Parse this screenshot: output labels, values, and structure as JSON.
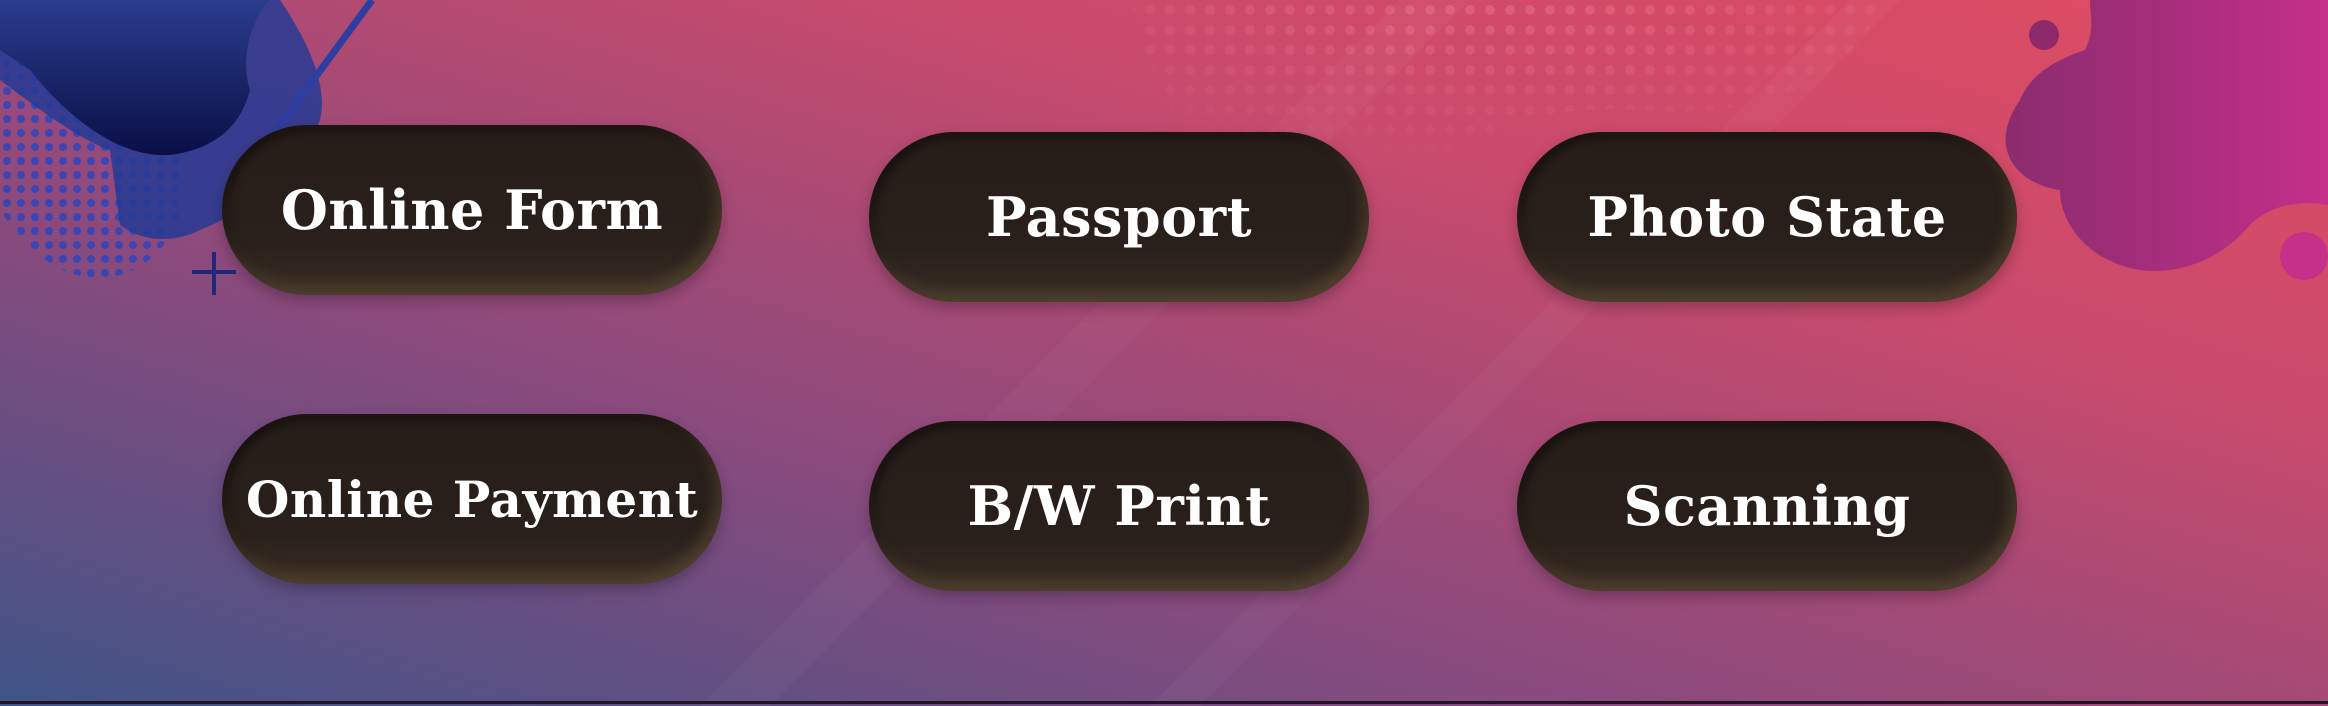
{
  "theme": {
    "bg_left": "#3f4f86",
    "bg_mid": "#8f4a7c",
    "bg_right": "#dc4c6a",
    "button_color": "#261c18",
    "button_text_color": "#ffffff",
    "blob_blue": "#1e2a78",
    "blob_magenta": "#b02d88"
  },
  "buttons": [
    {
      "label": "Online Form"
    },
    {
      "label": "Passport"
    },
    {
      "label": "Photo State"
    },
    {
      "label": "Online Payment"
    },
    {
      "label": "B/W Print"
    },
    {
      "label": "Scanning"
    }
  ],
  "decor": {
    "plus_icon": "plus-icon",
    "dots_pattern": "halftone-dots",
    "blob_top_left": "blue-blob",
    "blob_top_right": "magenta-blob"
  }
}
